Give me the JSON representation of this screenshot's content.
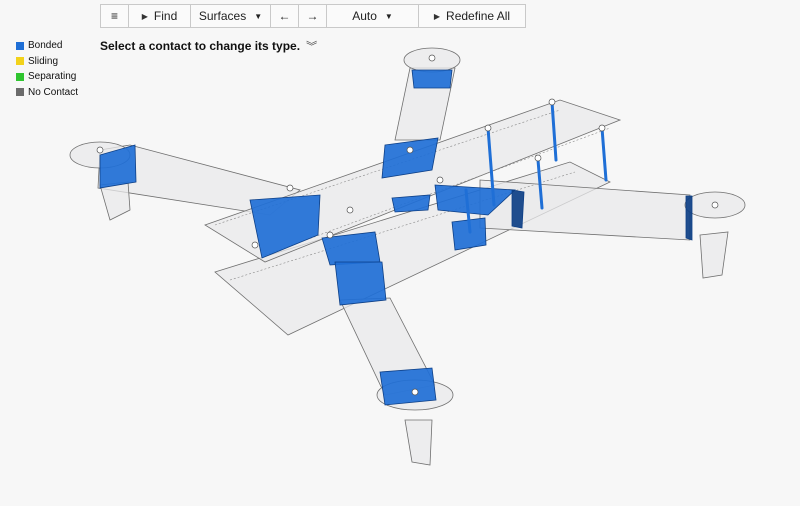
{
  "toolbar": {
    "menu_label": "≡",
    "find_label": "Find",
    "surfaces_label": "Surfaces",
    "back_label": "←",
    "forward_label": "→",
    "auto_label": "Auto",
    "redefine_label": "Redefine All"
  },
  "legend": [
    {
      "label": "Bonded",
      "color": "#1f6fd6"
    },
    {
      "label": "Sliding",
      "color": "#f2d21b"
    },
    {
      "label": "Separating",
      "color": "#2fc52f"
    },
    {
      "label": "No Contact",
      "color": "#6b6b6b"
    }
  ],
  "instruction": "Select a contact to change its type.",
  "colors": {
    "bonded": "#1f6fd6",
    "model_fill": "#e9e9eb",
    "model_edge": "#6f6f6f"
  }
}
